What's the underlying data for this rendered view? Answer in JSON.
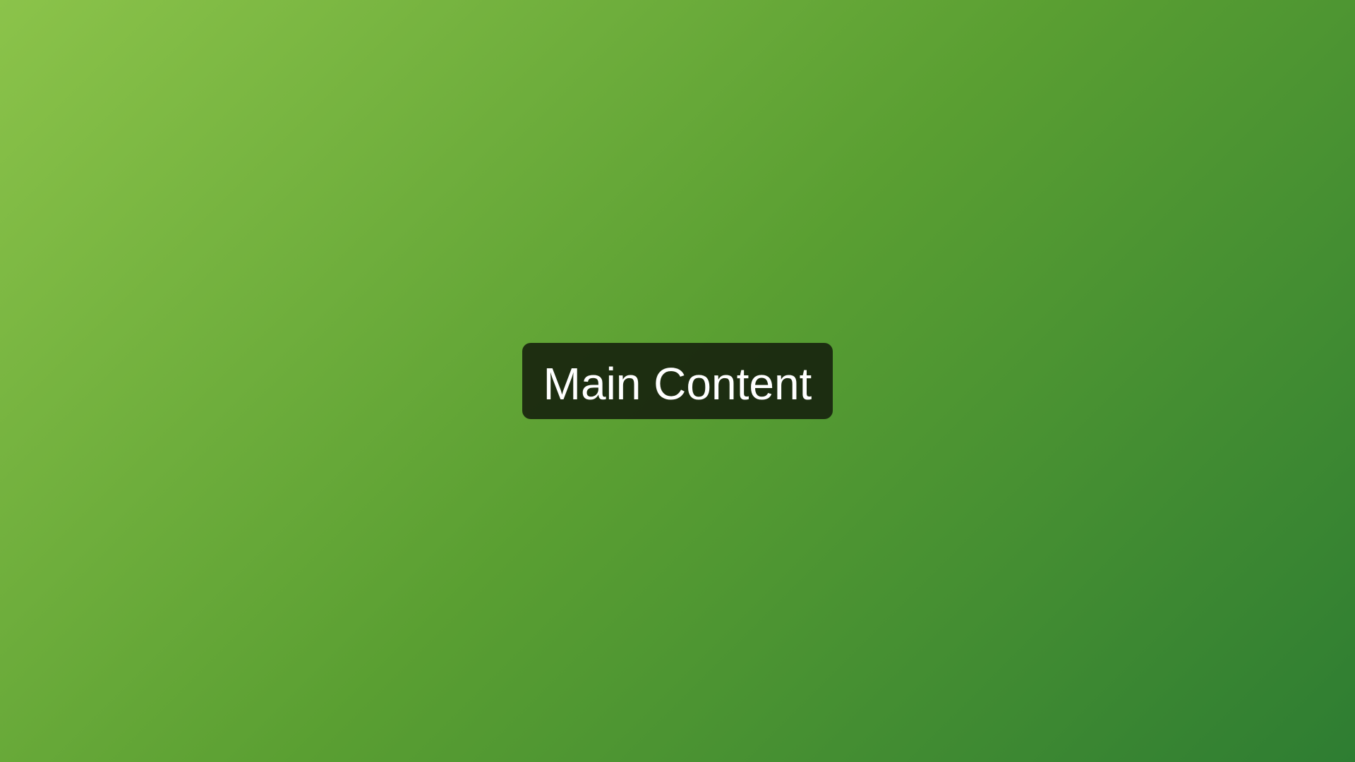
{
  "main": {
    "label": "Main Content"
  },
  "colors": {
    "background_start": "#8bc34a",
    "background_end": "#2e7d32",
    "label_background": "#1c2a10",
    "label_text": "#ffffff"
  }
}
